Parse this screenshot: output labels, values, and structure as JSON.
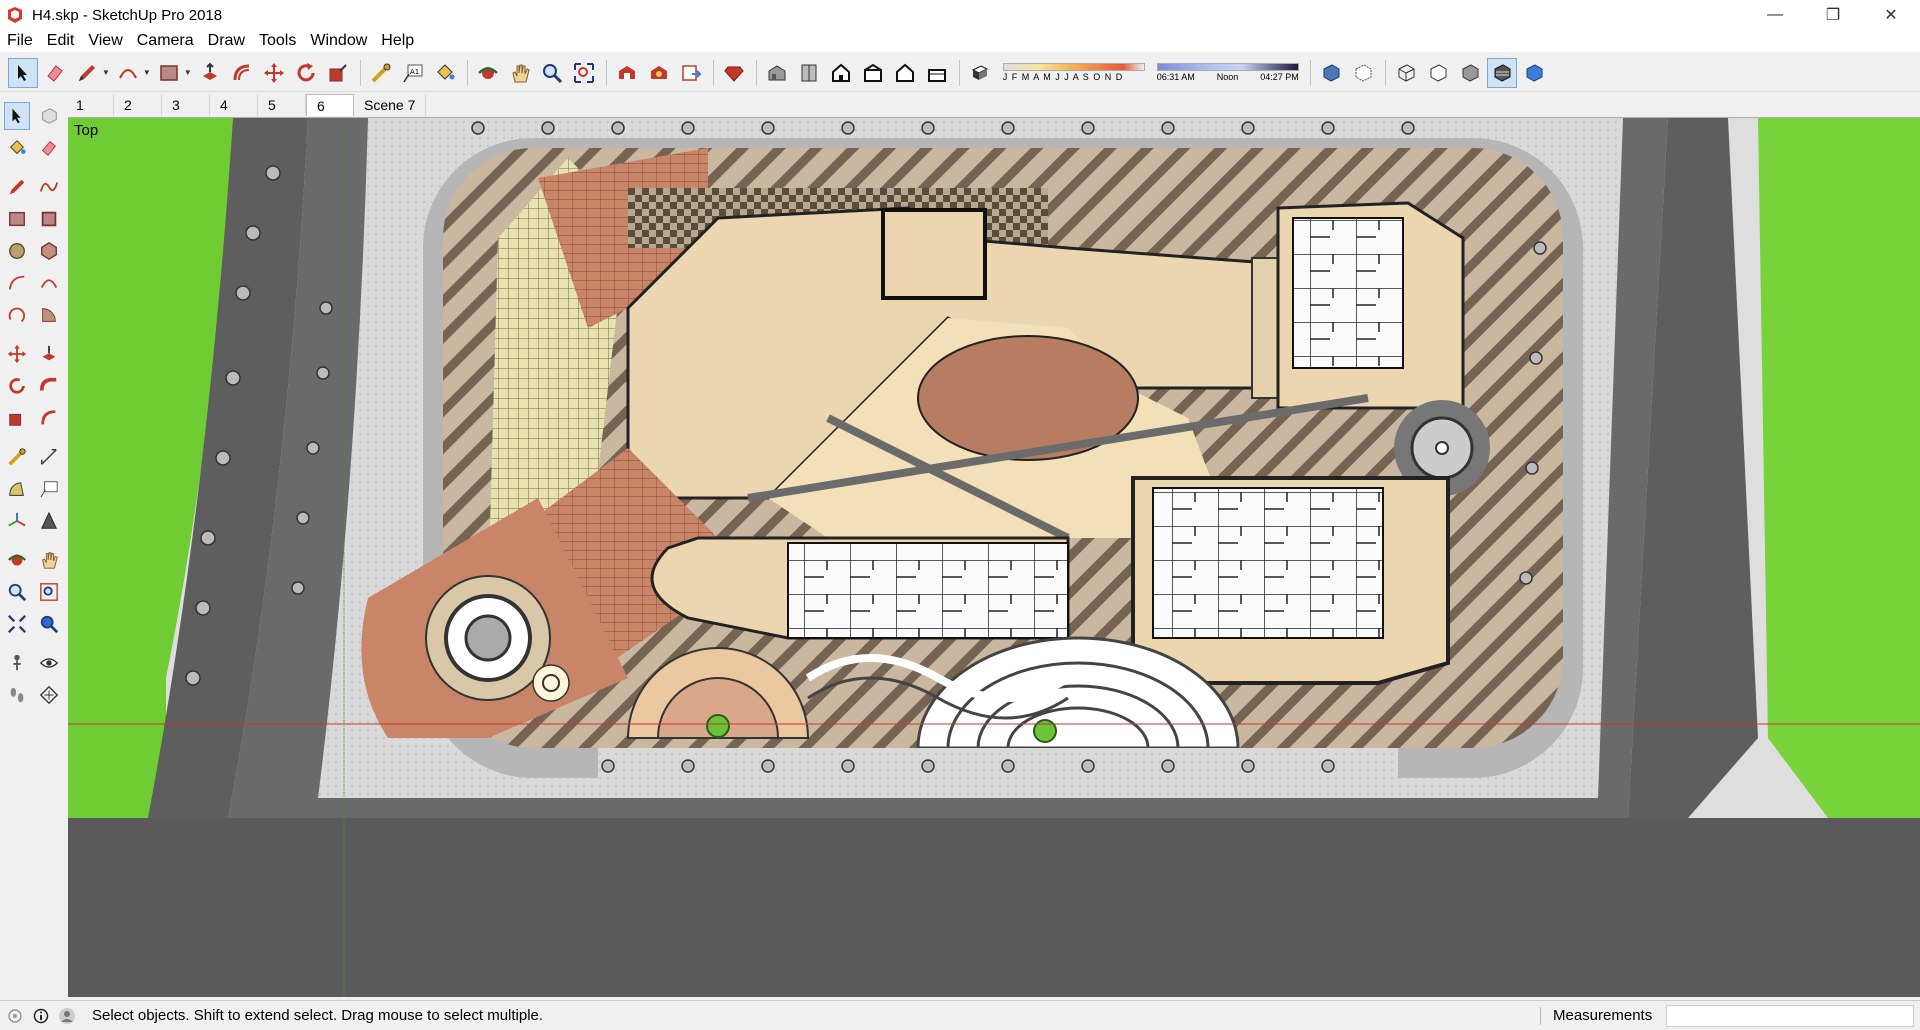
{
  "window": {
    "title": "H4.skp - SketchUp Pro 2018",
    "controls": {
      "minimize": "—",
      "restore": "❐",
      "close": "✕"
    }
  },
  "menu": [
    "File",
    "Edit",
    "View",
    "Camera",
    "Draw",
    "Tools",
    "Window",
    "Help"
  ],
  "toolbar": {
    "shadow_months": "J F M A M J J A S O N D",
    "time_start": "06:31 AM",
    "time_mid": "Noon",
    "time_end": "04:27 PM"
  },
  "scenes": {
    "tabs": [
      "1",
      "2",
      "3",
      "4",
      "5",
      "6",
      "Scene 7"
    ],
    "active_index": 5
  },
  "viewport": {
    "view_name": "Top"
  },
  "status": {
    "hint": "Select objects. Shift to extend select. Drag mouse to select multiple.",
    "measurements_label": "Measurements",
    "measurements_value": ""
  },
  "colors": {
    "accent": "#cfe3f7",
    "grass": "#7ccf3a",
    "road": "#5e5e5e",
    "paving": "#c9b7a0",
    "building": "#ecd6b0",
    "axis_red": "#cc3333",
    "axis_green": "#3a9a3a"
  }
}
